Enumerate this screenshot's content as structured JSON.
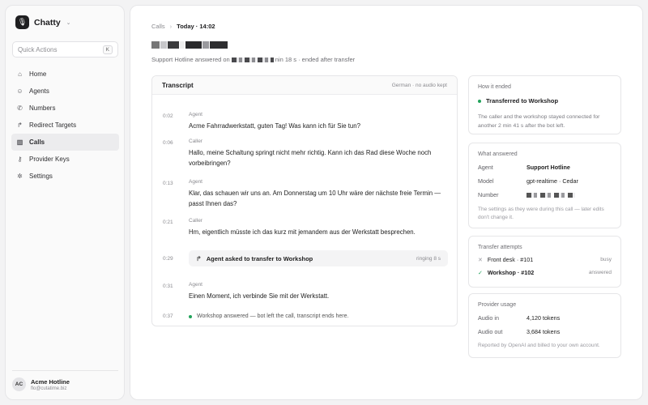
{
  "sidebar": {
    "app_name": "Chatty",
    "quick_actions": "Quick Actions",
    "quick_key": "K",
    "items": [
      {
        "label": "Home",
        "icon": "home-icon"
      },
      {
        "label": "Agents",
        "icon": "robot-icon"
      },
      {
        "label": "Numbers",
        "icon": "phone-icon"
      },
      {
        "label": "Redirect Targets",
        "icon": "redirect-icon"
      },
      {
        "label": "Calls",
        "icon": "chart-icon",
        "active": true
      },
      {
        "label": "Provider Keys",
        "icon": "key-icon"
      },
      {
        "label": "Settings",
        "icon": "gear-icon"
      }
    ],
    "user": {
      "initials": "AC",
      "name": "Acme Hotline",
      "email": "flo@cutatime.biz"
    }
  },
  "header": {
    "breadcrumb_root": "Calls",
    "breadcrumb_current": "Today · 14:02",
    "subtitle_prefix": "Support Hotline answered on",
    "subtitle_suffix": "nin 18 s · ended after transfer"
  },
  "transcript": {
    "title": "Transcript",
    "meta": "German · no audio kept",
    "entries": [
      {
        "time": "0:02",
        "speaker": "Agent",
        "text": "Acme Fahrradwerkstatt, guten Tag! Was kann ich für Sie tun?"
      },
      {
        "time": "0:06",
        "speaker": "Caller",
        "text": "Hallo, meine Schaltung springt nicht mehr richtig. Kann ich das Rad diese Woche noch vorbeibringen?"
      },
      {
        "time": "0:13",
        "speaker": "Agent",
        "text": "Klar, das schauen wir uns an. Am Donnerstag um 10 Uhr wäre der nächste freie Termin — passt Ihnen das?"
      },
      {
        "time": "0:21",
        "speaker": "Caller",
        "text": "Hm, eigentlich müsste ich das kurz mit jemandem aus der Werkstatt besprechen."
      },
      {
        "time": "0:31",
        "speaker": "Agent",
        "text": "Einen Moment, ich verbinde Sie mit der Werkstatt."
      }
    ],
    "transfer": {
      "time": "0:29",
      "label": "Agent asked to transfer to Workshop",
      "status": "ringing 8 s"
    },
    "end": {
      "time": "0:37",
      "text": "Workshop answered — bot left the call, transcript ends here."
    }
  },
  "how_ended": {
    "title": "How it ended",
    "status": "Transferred to Workshop",
    "note": "The caller and the workshop stayed connected for another 2 min 41 s after the bot left."
  },
  "what_answered": {
    "title": "What answered",
    "agent_label": "Agent",
    "agent_value": "Support Hotline",
    "model_label": "Model",
    "model_value": "gpt-realtime · Cedar",
    "number_label": "Number",
    "note": "The settings as they were during this call — later edits don't change it."
  },
  "transfer_attempts": {
    "title": "Transfer attempts",
    "items": [
      {
        "name": "Front desk · #101",
        "status": "busy"
      },
      {
        "name": "Workshop · #102",
        "status": "answered"
      }
    ]
  },
  "usage": {
    "title": "Provider usage",
    "in_label": "Audio in",
    "in_value": "4,120 tokens",
    "out_label": "Audio out",
    "out_value": "3,684 tokens",
    "note": "Reported by OpenAI and billed to your own account."
  },
  "colors": {
    "accent": "#22a35b",
    "dark": "#1f1f21"
  }
}
